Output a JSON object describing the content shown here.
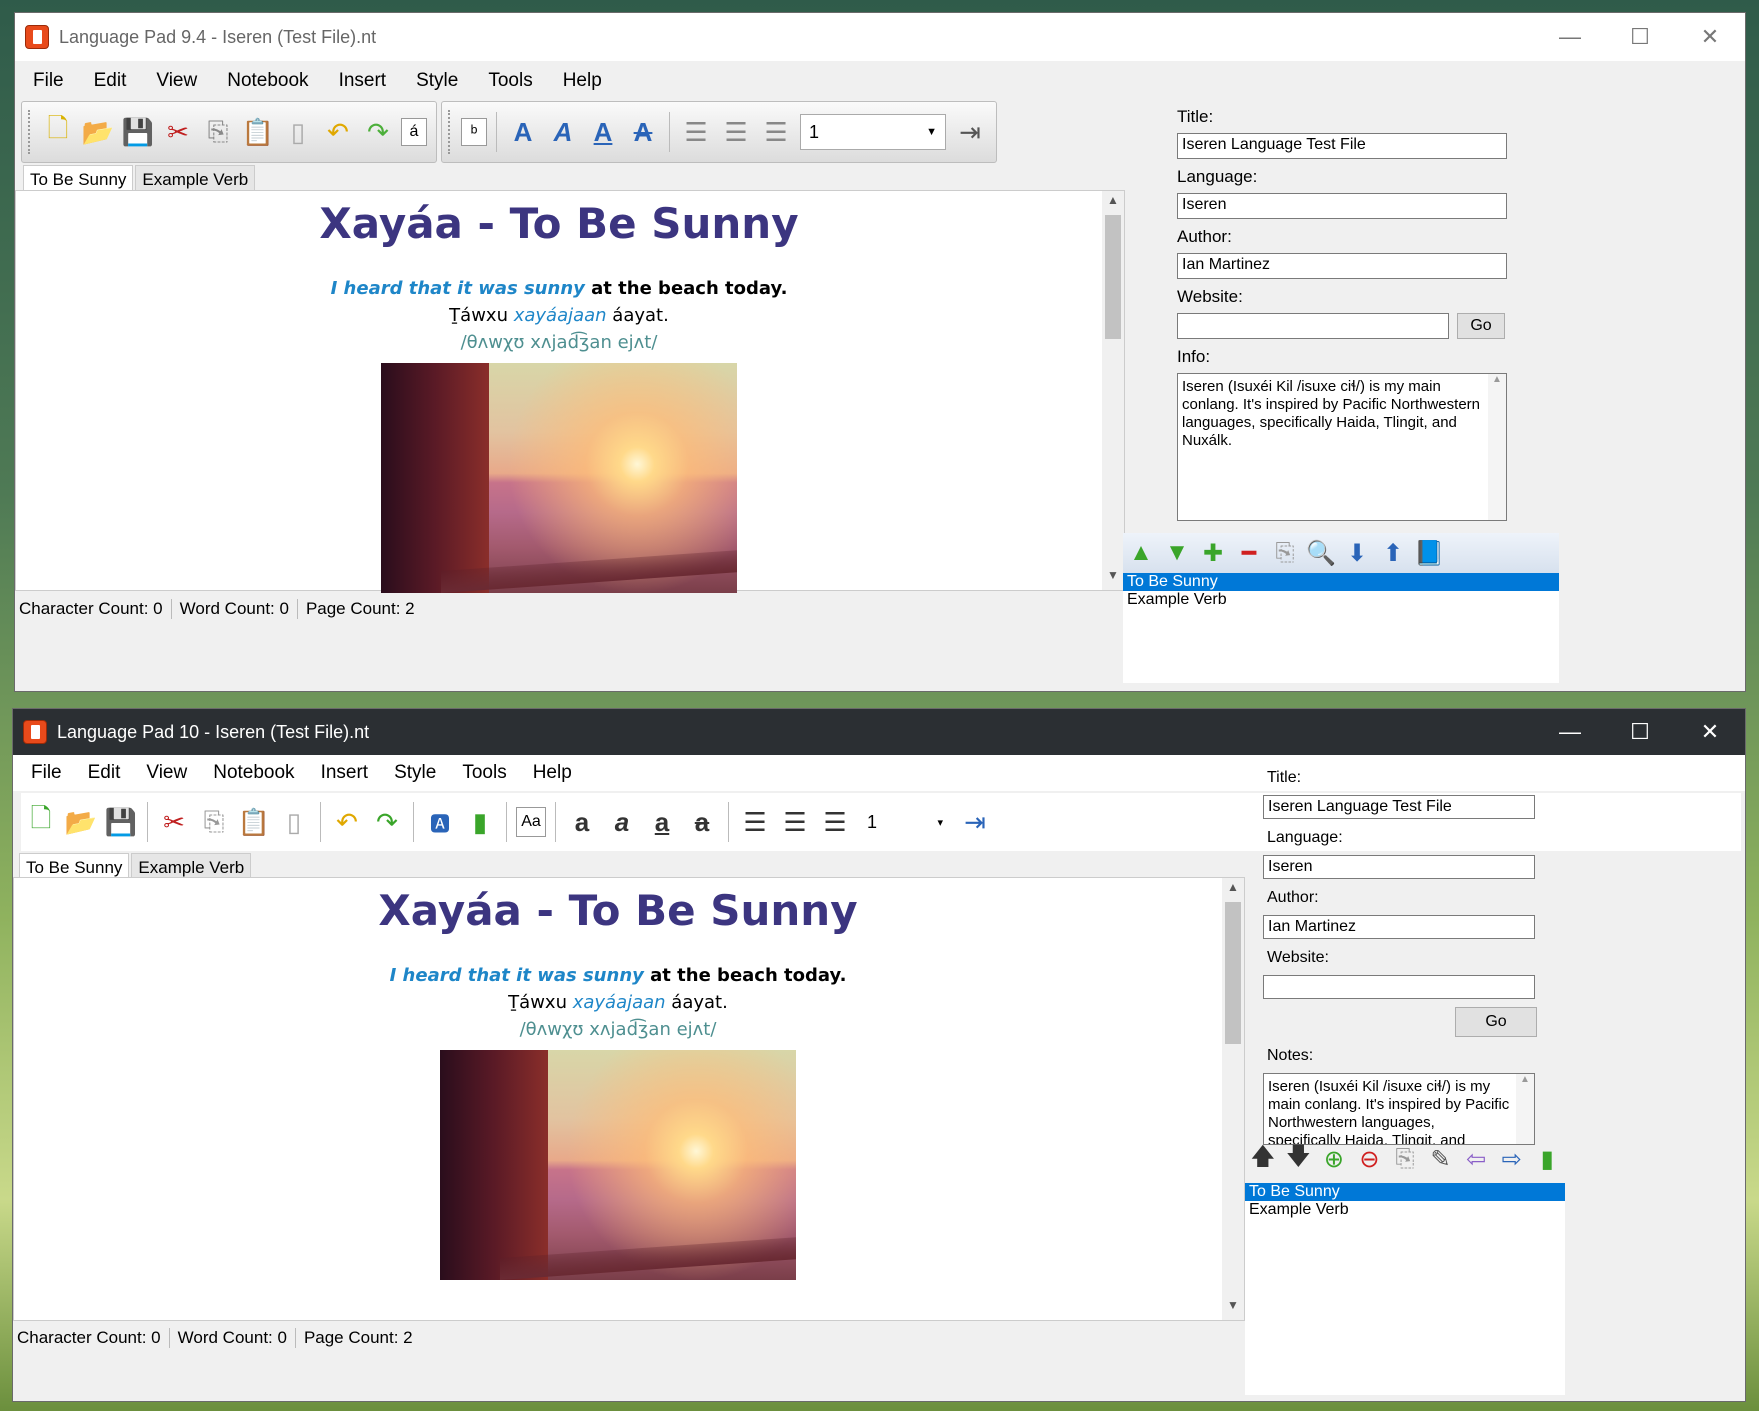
{
  "w1": {
    "title": "Language Pad 9.4 - Iseren (Test File).nt",
    "menu": [
      "File",
      "Edit",
      "View",
      "Notebook",
      "Insert",
      "Style",
      "Tools",
      "Help"
    ],
    "size_value": "1",
    "tabs": [
      "To Be Sunny",
      "Example Verb"
    ],
    "doc": {
      "title": "Xayáa - To Be Sunny",
      "line1_italic": "I heard that it was sunny",
      "line1_rest": " at the beach today.",
      "line2_pre": "Ṯáwxu ",
      "line2_italic": "xayáajaan",
      "line2_post": " áayat.",
      "line3": "/θʌwχʊ xʌjad͡ʒan ejʌt/"
    },
    "status": {
      "chars": "Character Count: 0",
      "words": "Word Count: 0",
      "pages": "Page Count: 2"
    },
    "side": {
      "title_label": "Title:",
      "title_value": "Iseren Language Test File",
      "language_label": "Language:",
      "language_value": "Iseren",
      "author_label": "Author:",
      "author_value": "Ian Martinez",
      "website_label": "Website:",
      "website_value": "",
      "go_label": "Go",
      "info_label": "Info:",
      "info_value": "Iseren (Isuxéi Kil /isuxe ciɬ/) is my main conlang. It's inspired by Pacific Northwestern languages, specifically Haida, Tlingit, and Nuxálk."
    },
    "pages": [
      "To Be Sunny",
      "Example Verb"
    ]
  },
  "w2": {
    "title": "Language Pad 10 - Iseren (Test File).nt",
    "menu": [
      "File",
      "Edit",
      "View",
      "Notebook",
      "Insert",
      "Style",
      "Tools",
      "Help"
    ],
    "size_value": "1",
    "tabs": [
      "To Be Sunny",
      "Example Verb"
    ],
    "doc": {
      "title": "Xayáa - To Be Sunny",
      "line1_italic": "I heard that it was sunny",
      "line1_rest": " at the beach today.",
      "line2_pre": "Ṯáwxu ",
      "line2_italic": "xayáajaan",
      "line2_post": " áayat.",
      "line3": "/θʌwχʊ xʌjad͡ʒan ejʌt/"
    },
    "status": {
      "chars": "Character Count: 0",
      "words": "Word Count: 0",
      "pages": "Page Count: 2"
    },
    "side": {
      "title_label": "Title:",
      "title_value": "Iseren Language Test File",
      "language_label": "Language:",
      "language_value": "Iseren",
      "author_label": "Author:",
      "author_value": "Ian Martinez",
      "website_label": "Website:",
      "website_value": "",
      "go_label": "Go",
      "notes_label": "Notes:",
      "notes_value": "Iseren (Isuxéi Kil /isuxe ciɬ/) is my main conlang. It's inspired by Pacific Northwestern languages, specifically Haida, Tlingit, and Nuxálk."
    },
    "pages": [
      "To Be Sunny",
      "Example Verb"
    ]
  },
  "icons": {
    "toolbar": [
      "new-file-icon",
      "open-folder-icon",
      "save-icon",
      "cut-icon",
      "copy-icon",
      "paste-icon",
      "page-icon",
      "undo-icon",
      "redo-icon",
      "insert-char-icon",
      "ipa-chart-icon",
      "font-regular-icon",
      "font-italic-icon",
      "font-underline-icon",
      "font-strike-icon",
      "align-left-icon",
      "align-center-icon",
      "align-right-icon",
      "indent-icon"
    ],
    "page_tools": [
      "move-up-icon",
      "move-down-icon",
      "add-page-icon",
      "remove-page-icon",
      "duplicate-icon",
      "edit-icon",
      "import-icon",
      "export-icon",
      "notebook-icon"
    ]
  },
  "colors": {
    "heading": "#3c3580",
    "accent_italic": "#1e86c8",
    "ipa": "#4e8f90",
    "selection": "#0078d7"
  }
}
